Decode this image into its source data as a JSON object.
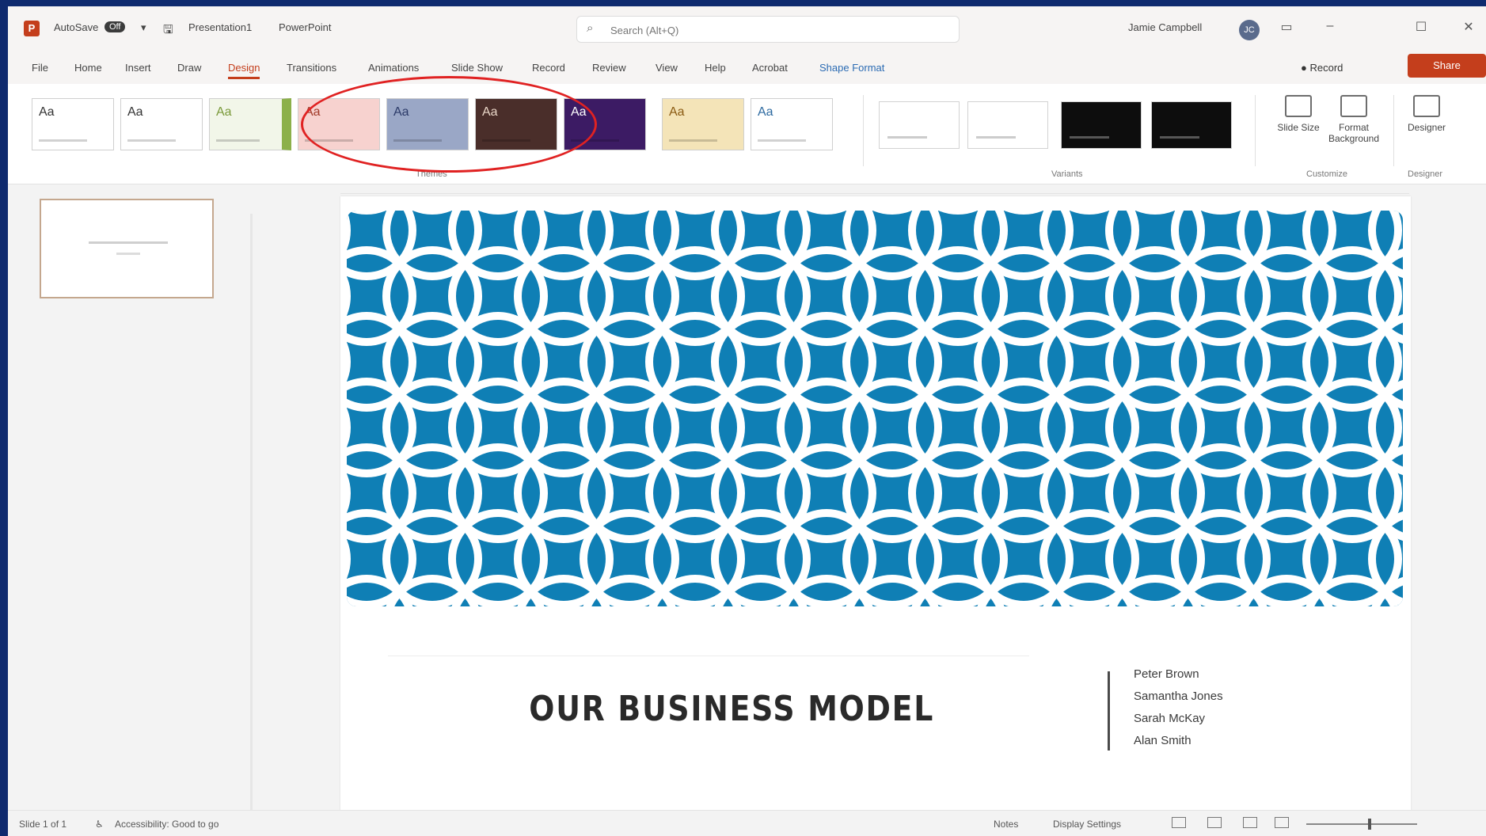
{
  "app": {
    "autosave_label": "AutoSave",
    "autosave_state": "Off",
    "file_name": "Presentation1",
    "suffix": "PowerPoint",
    "logo": "P"
  },
  "search": {
    "placeholder": "Search (Alt+Q)"
  },
  "user": {
    "name": "Jamie Campbell",
    "initials": "JC"
  },
  "tabs": [
    {
      "label": "File"
    },
    {
      "label": "Home"
    },
    {
      "label": "Insert"
    },
    {
      "label": "Draw"
    },
    {
      "label": "Design"
    },
    {
      "label": "Transitions"
    },
    {
      "label": "Animations"
    },
    {
      "label": "Slide Show"
    },
    {
      "label": "Record"
    },
    {
      "label": "Review"
    },
    {
      "label": "View"
    },
    {
      "label": "Help"
    },
    {
      "label": "Acrobat"
    },
    {
      "label": "Shape Format"
    }
  ],
  "toolbar": {
    "record_label": "Record",
    "share_label": "Share"
  },
  "themes": [
    {
      "aa": "Aa",
      "bg": "#ffffff",
      "fg": "#333333"
    },
    {
      "aa": "Aa",
      "bg": "#ffffff",
      "fg": "#333333"
    },
    {
      "aa": "Aa",
      "bg": "#f2f6e9",
      "fg": "#7a9a3a",
      "accent": "#8cb04a"
    },
    {
      "aa": "Aa",
      "bg": "#f7d2cf",
      "fg": "#a23b2a"
    },
    {
      "aa": "Aa",
      "bg": "#9aa7c6",
      "fg": "#2b3a68"
    },
    {
      "aa": "Aa",
      "bg": "#4a2e2a",
      "fg": "#ead7c8"
    },
    {
      "aa": "Aa",
      "bg": "#3c1b64",
      "fg": "#ffffff"
    },
    {
      "aa": "Aa",
      "bg": "#f4e4b8",
      "fg": "#8a5a12"
    },
    {
      "aa": "Aa",
      "bg": "#ffffff",
      "fg": "#2d6aa0"
    }
  ],
  "variants": [
    {
      "bg": "#ffffff"
    },
    {
      "bg": "#ffffff"
    },
    {
      "bg": "#0d0d0d"
    },
    {
      "bg": "#0d0d0d"
    }
  ],
  "ribbon": {
    "themes_group": "Themes",
    "variants_group": "Variants",
    "customize_group": "Customize",
    "designer_group": "Designer",
    "slide_size": "Slide Size",
    "format_background": "Format Background",
    "designer": "Designer"
  },
  "slide": {
    "title": "OUR BUSINESS MODEL",
    "authors": [
      "Peter Brown",
      "Samantha Jones",
      "Sarah McKay",
      "Alan Smith"
    ],
    "pattern_bg": "#0f7fb5",
    "pattern_fg": "#ffffff"
  },
  "statusbar": {
    "slide_info": "Slide 1 of 1",
    "accessibility": "Accessibility: Good to go",
    "notes": "Notes",
    "display_settings": "Display Settings"
  }
}
